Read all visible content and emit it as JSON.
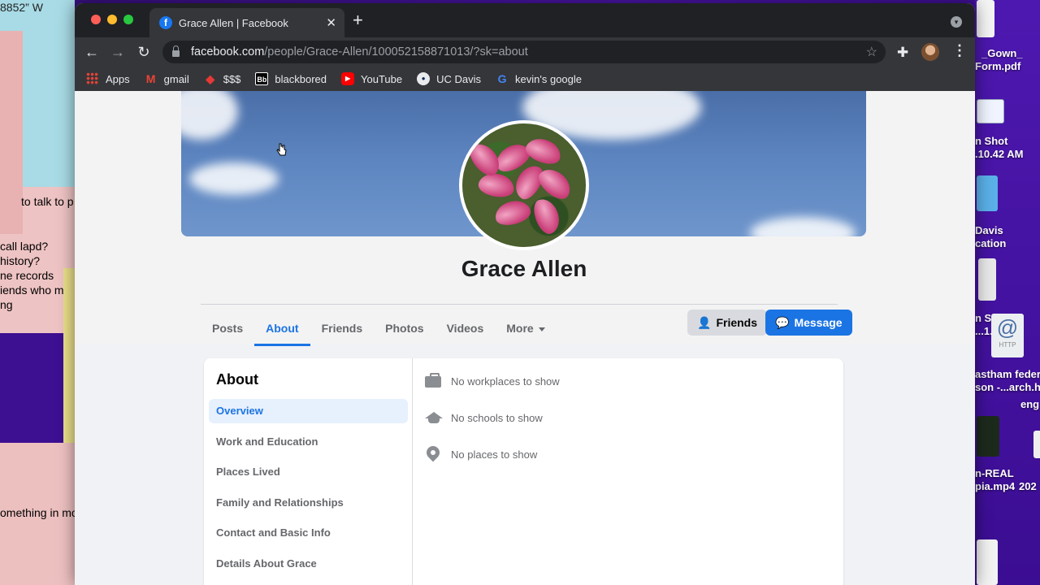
{
  "desktop": {
    "coord_text": "8852” W",
    "notes": [
      "to talk to p",
      "call lapd?",
      "history?",
      "ne records",
      "iends who m",
      "ng",
      "omething in mo"
    ],
    "right_labels": [
      "_Gown_",
      "Form.pdf",
      "n Shot",
      ".10.42 AM",
      "Davis",
      "cation",
      "n Sh",
      "...1.",
      "astham feder",
      "son -...arch.h",
      "eng",
      "n-REAL",
      "pia.mp4",
      "202"
    ],
    "http_label": "HTTP"
  },
  "browser": {
    "tab_title": "Grace Allen | Facebook",
    "url_host": "facebook.com",
    "url_path": "/people/Grace-Allen/100052158871013/?sk=about",
    "bookmarks": [
      "Apps",
      "gmail",
      "$$$",
      "blackbored",
      "YouTube",
      "UC Davis",
      "kevin's google"
    ]
  },
  "profile": {
    "name": "Grace Allen",
    "tabs": [
      "Posts",
      "About",
      "Friends",
      "Photos",
      "Videos",
      "More"
    ],
    "active_tab": "About",
    "friends_button": "Friends",
    "message_button": "Message"
  },
  "about": {
    "title": "About",
    "menu": [
      "Overview",
      "Work and Education",
      "Places Lived",
      "Family and Relationships",
      "Contact and Basic Info",
      "Details About Grace"
    ],
    "active_menu": "Overview",
    "items": [
      "No workplaces to show",
      "No schools to show",
      "No places to show"
    ]
  },
  "colors": {
    "facebook_blue": "#1b74e4",
    "chrome_dark": "#202124",
    "chrome_toolbar": "#35363a"
  }
}
